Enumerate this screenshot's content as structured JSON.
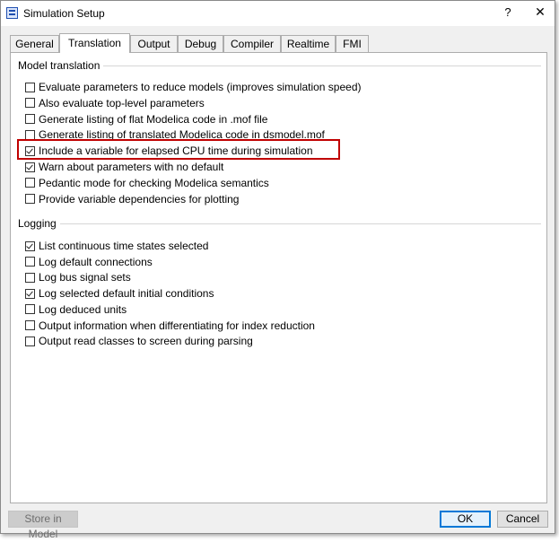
{
  "window": {
    "title": "Simulation Setup",
    "help_label": "?",
    "close_label": "✕"
  },
  "tabs": [
    "General",
    "Translation",
    "Output",
    "Debug",
    "Compiler",
    "Realtime",
    "FMI"
  ],
  "active_tab": "Translation",
  "model_translation": {
    "label": "Model translation",
    "options": [
      {
        "label": "Evaluate parameters to reduce models (improves simulation speed)",
        "checked": false
      },
      {
        "label": "Also evaluate top-level parameters",
        "checked": false
      },
      {
        "label": "Generate listing of flat Modelica code in .mof file",
        "checked": false
      },
      {
        "label": "Generate listing of translated Modelica code in dsmodel.mof",
        "checked": false
      },
      {
        "label": "Include a variable for elapsed CPU time during simulation",
        "checked": true
      },
      {
        "label": "Warn about parameters with no default",
        "checked": true
      },
      {
        "label": "Pedantic mode for checking Modelica semantics",
        "checked": false
      },
      {
        "label": "Provide variable dependencies for plotting",
        "checked": false
      }
    ]
  },
  "logging": {
    "label": "Logging",
    "options": [
      {
        "label": "List continuous time states selected",
        "checked": true
      },
      {
        "label": "Log default connections",
        "checked": false
      },
      {
        "label": "Log bus signal sets",
        "checked": false
      },
      {
        "label": "Log selected default initial conditions",
        "checked": true
      },
      {
        "label": "Log deduced units",
        "checked": false
      },
      {
        "label": "Output information when differentiating for index reduction",
        "checked": false
      },
      {
        "label": "Output read classes to screen during parsing",
        "checked": false
      }
    ]
  },
  "buttons": {
    "store": "Store in Model",
    "ok": "OK",
    "cancel": "Cancel"
  },
  "colors": {
    "highlight": "#c00000",
    "ok_border": "#0078d7"
  }
}
